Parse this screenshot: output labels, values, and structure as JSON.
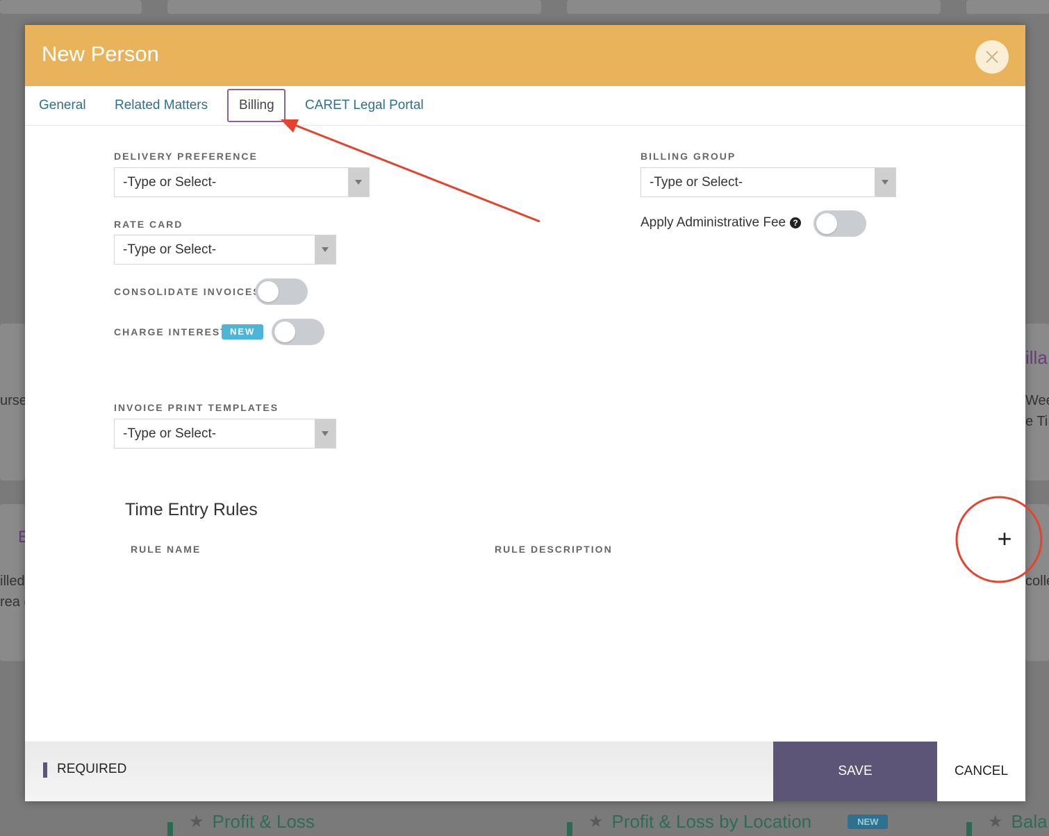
{
  "background": {
    "left_snippets": [
      "urse",
      "illed",
      "rea c"
    ],
    "left_letter": "E",
    "right_snippets": [
      "illa",
      "Wee",
      "e Ti",
      "colle"
    ],
    "bottom_cards": [
      {
        "title": "Profit & Loss",
        "badge": ""
      },
      {
        "title": "Profit & Loss by Location",
        "badge": "NEW"
      },
      {
        "title": "Bala",
        "badge": ""
      }
    ]
  },
  "modal": {
    "title": "New Person",
    "tabs": [
      {
        "label": "General"
      },
      {
        "label": "Related Matters"
      },
      {
        "label": "Billing"
      },
      {
        "label": "CARET Legal Portal"
      }
    ],
    "active_tab": "Billing"
  },
  "billing": {
    "delivery_preference": {
      "label": "DELIVERY PREFERENCE",
      "value": "-Type or Select-"
    },
    "billing_group": {
      "label": "BILLING GROUP",
      "value": "-Type or Select-"
    },
    "apply_admin_fee": {
      "label": "Apply Administrative Fee",
      "help": "?",
      "on": false
    },
    "rate_card": {
      "label": "RATE CARD",
      "value": "-Type or Select-"
    },
    "consolidate_invoices": {
      "label": "CONSOLIDATE INVOICES",
      "on": false
    },
    "charge_interest": {
      "label": "CHARGE INTEREST",
      "badge": "NEW",
      "on": false
    },
    "invoice_print_templates": {
      "label": "INVOICE PRINT TEMPLATES",
      "value": "-Type or Select-"
    }
  },
  "time_entry_rules": {
    "title": "Time Entry Rules",
    "columns": [
      "RULE NAME",
      "RULE DESCRIPTION"
    ],
    "add_symbol": "+",
    "rows": []
  },
  "footer": {
    "required_label": "REQUIRED",
    "save_label": "SAVE",
    "cancel_label": "CANCEL"
  },
  "colors": {
    "header": "#e8b35b",
    "tab_link": "#2d6e93",
    "primary_button": "#5c5577",
    "new_badge": "#4db5d8",
    "annotation_red": "#e5432e",
    "annotation_purple": "#8b5fa8"
  }
}
